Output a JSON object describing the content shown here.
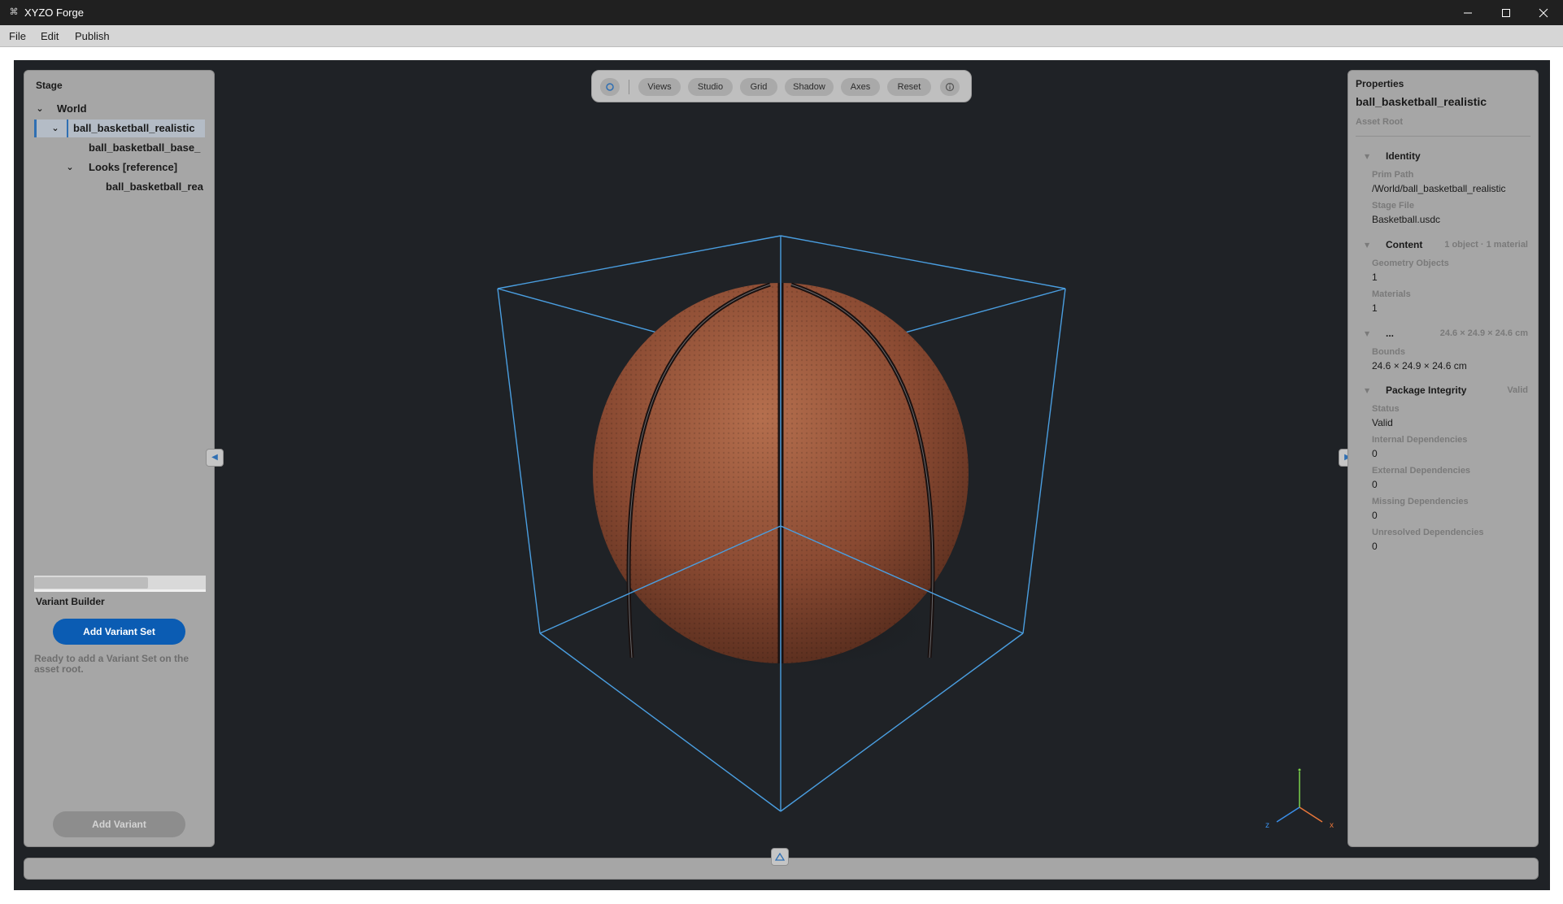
{
  "window": {
    "title": "XYZO Forge",
    "icon": "xyzo-logo-icon",
    "controls": [
      "minimize-icon",
      "maximize-icon",
      "close-icon"
    ]
  },
  "menu": {
    "items": [
      {
        "label": "File"
      },
      {
        "label": "Edit"
      },
      {
        "label": "Publish"
      }
    ]
  },
  "stage": {
    "title": "Stage",
    "tree": [
      {
        "label": "World",
        "expanded": true,
        "selected": false
      },
      {
        "label": "ball_basketball_realistic",
        "expanded": true,
        "selected": true
      },
      {
        "label": "ball_basketball_base_",
        "selected": false
      },
      {
        "label": "Looks  [reference]",
        "expanded": true,
        "selected": false
      },
      {
        "label": "ball_basketball_rea",
        "selected": false
      }
    ],
    "variant_builder": {
      "title": "Variant Builder",
      "add_set_label": "Add Variant Set",
      "status": "Ready to add a Variant Set on the asset root.",
      "add_variant_label": "Add Variant"
    }
  },
  "viewport": {
    "toolbar": {
      "buttons": [
        {
          "label": "Views"
        },
        {
          "label": "Studio"
        },
        {
          "label": "Grid"
        },
        {
          "label": "Shadow"
        },
        {
          "label": "Axes"
        },
        {
          "label": "Reset"
        }
      ],
      "icons": [
        "orbit-icon",
        "info-icon"
      ]
    },
    "axes": {
      "x": "x",
      "z": "z"
    },
    "colors": {
      "background": "#1f2226",
      "bbox": "#4a9ee0",
      "ball": "#8a4a32"
    }
  },
  "properties": {
    "title": "Properties",
    "asset_name": "ball_basketball_realistic",
    "asset_kind": "Asset Root",
    "sections": {
      "identity": {
        "title": "Identity",
        "prim_path_label": "Prim Path",
        "prim_path": "/World/ball_basketball_realistic",
        "stage_file_label": "Stage File",
        "stage_file": "Basketball.usdc"
      },
      "content": {
        "title": "Content",
        "summary": "1 object · 1 material",
        "geometry_label": "Geometry Objects",
        "geometry": "1",
        "materials_label": "Materials",
        "materials": "1"
      },
      "bounds": {
        "title": "...",
        "summary": "24.6 × 24.9 × 24.6 cm",
        "bounds_label": "Bounds",
        "bounds": "24.6 × 24.9 × 24.6 cm"
      },
      "integrity": {
        "title": "Package Integrity",
        "summary": "Valid",
        "status_label": "Status",
        "status": "Valid",
        "internal_label": "Internal Dependencies",
        "internal": "0",
        "external_label": "External Dependencies",
        "external": "0",
        "missing_label": "Missing Dependencies",
        "missing": "0",
        "unresolved_label": "Unresolved Dependencies",
        "unresolved": "0"
      }
    }
  }
}
